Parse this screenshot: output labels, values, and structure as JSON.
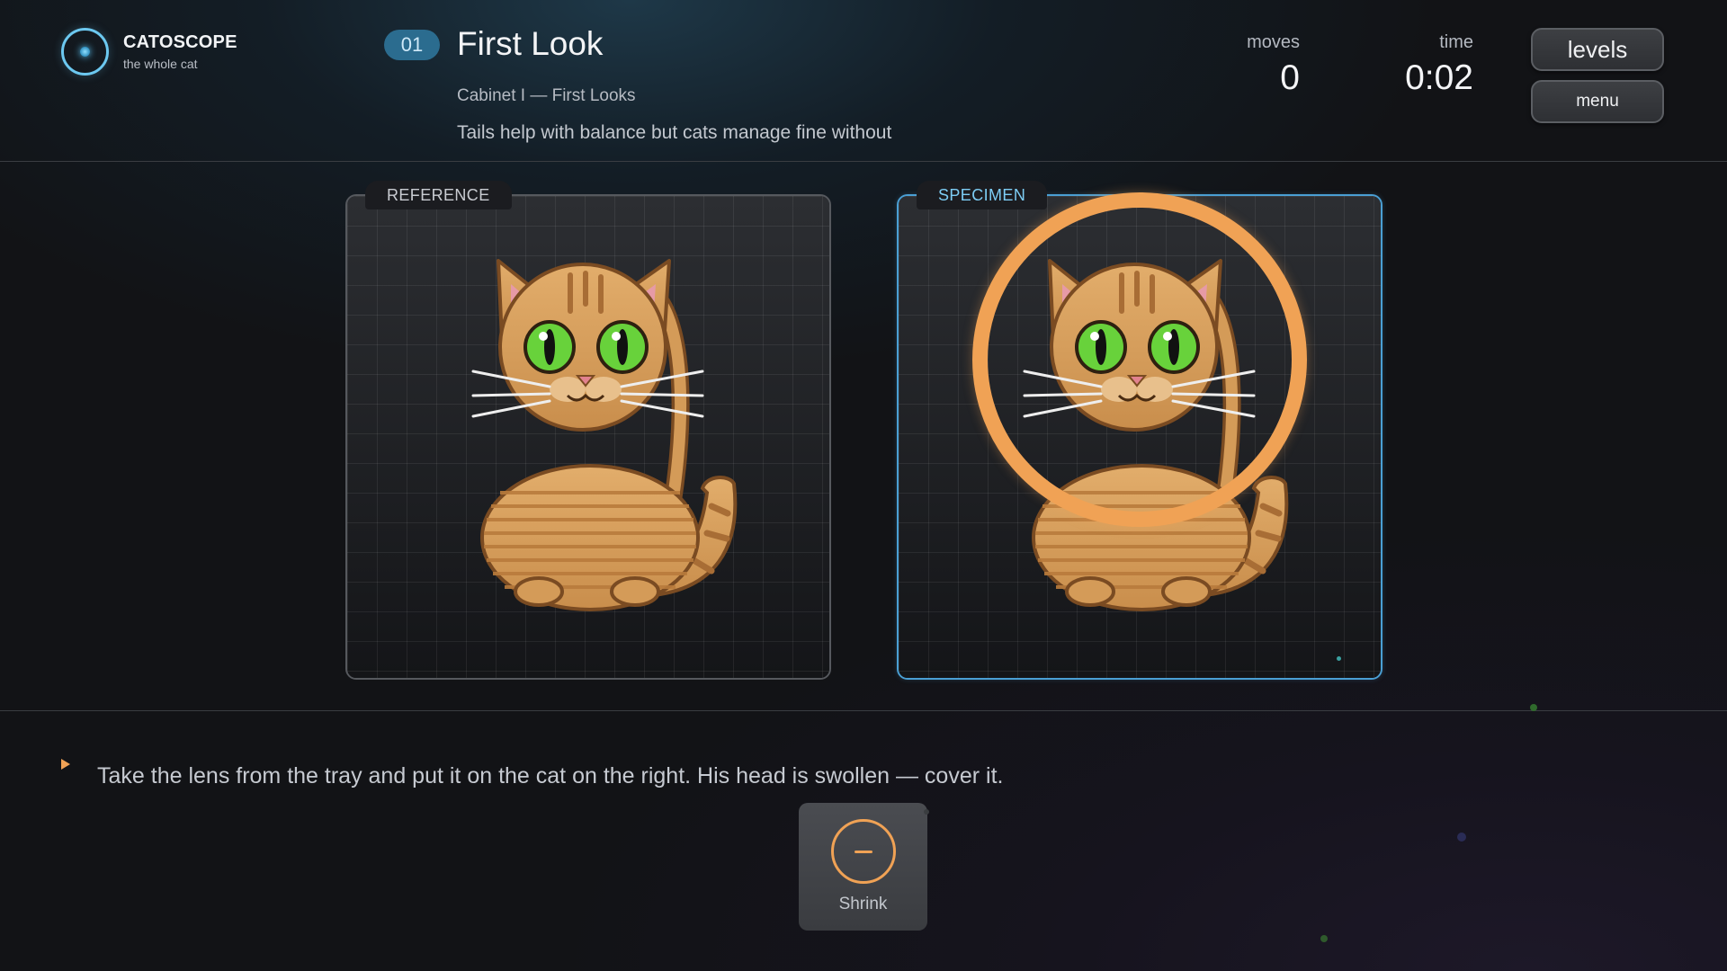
{
  "brand": {
    "title": "CATOSCOPE",
    "subtitle": "the whole cat"
  },
  "level": {
    "number": "01",
    "title": "First Look",
    "cabinet": "Cabinet I — First Looks",
    "hint": "Tails help with balance but cats manage fine without"
  },
  "stats": {
    "moves_label": "moves",
    "moves_value": "0",
    "time_label": "time",
    "time_value": "0:02"
  },
  "buttons": {
    "levels": "levels",
    "menu": "menu"
  },
  "panels": {
    "reference_label": "REFERENCE",
    "specimen_label": "SPECIMEN"
  },
  "instruction": "Take the lens from the tray and put it on the cat on the right. His head is swollen — cover it.",
  "tray": {
    "tool_label": "Shrink",
    "tool_icon": "minus-lens-icon"
  },
  "colors": {
    "accent": "#f0a255",
    "highlight": "#4a9fd4",
    "badge": "#2b6c8f",
    "cat_fur": "#d9a15f",
    "cat_eyes": "#6ad23c"
  }
}
